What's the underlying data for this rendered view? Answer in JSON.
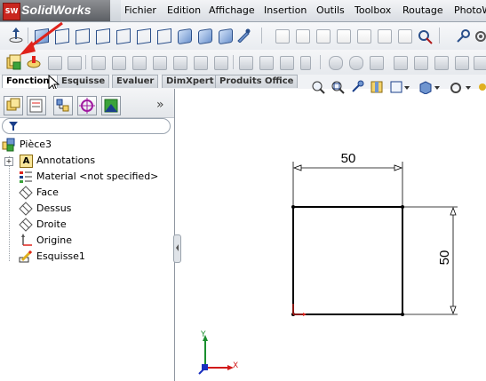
{
  "app": {
    "logo_mark": "SW",
    "logo_text": "SolidWorks"
  },
  "menu": {
    "items": [
      "Fichier",
      "Edition",
      "Affichage",
      "Insertion",
      "Outils",
      "Toolbox",
      "Routage",
      "PhotoW"
    ]
  },
  "command_tabs": [
    "Fonctions",
    "Esquisse",
    "Evaluer",
    "DimXpert",
    "Produits Office"
  ],
  "active_tab": "Fonctions",
  "panel": {
    "filter_icon": "filter-icon",
    "collapse_glyph": "»",
    "tree": {
      "root": "Pièce3",
      "items": [
        {
          "label": "Annotations",
          "icon": "annotations-icon",
          "expandable": true
        },
        {
          "label": "Material <not specified>",
          "icon": "material-icon",
          "expandable": false
        },
        {
          "label": "Face",
          "icon": "plane-icon",
          "expandable": false
        },
        {
          "label": "Dessus",
          "icon": "plane-icon",
          "expandable": false
        },
        {
          "label": "Droite",
          "icon": "plane-icon",
          "expandable": false
        },
        {
          "label": "Origine",
          "icon": "origin-icon",
          "expandable": false
        },
        {
          "label": "Esquisse1",
          "icon": "sketch-icon",
          "expandable": false
        }
      ]
    }
  },
  "sketch": {
    "dim_horizontal": "50",
    "dim_vertical": "50"
  },
  "triad": {
    "y_label": "Y",
    "x_label": "X"
  },
  "colors": {
    "accent_red": "#e0231c",
    "triad_x": "#d11a1a",
    "triad_y": "#1a8f2e",
    "triad_z": "#1a2fbf"
  }
}
